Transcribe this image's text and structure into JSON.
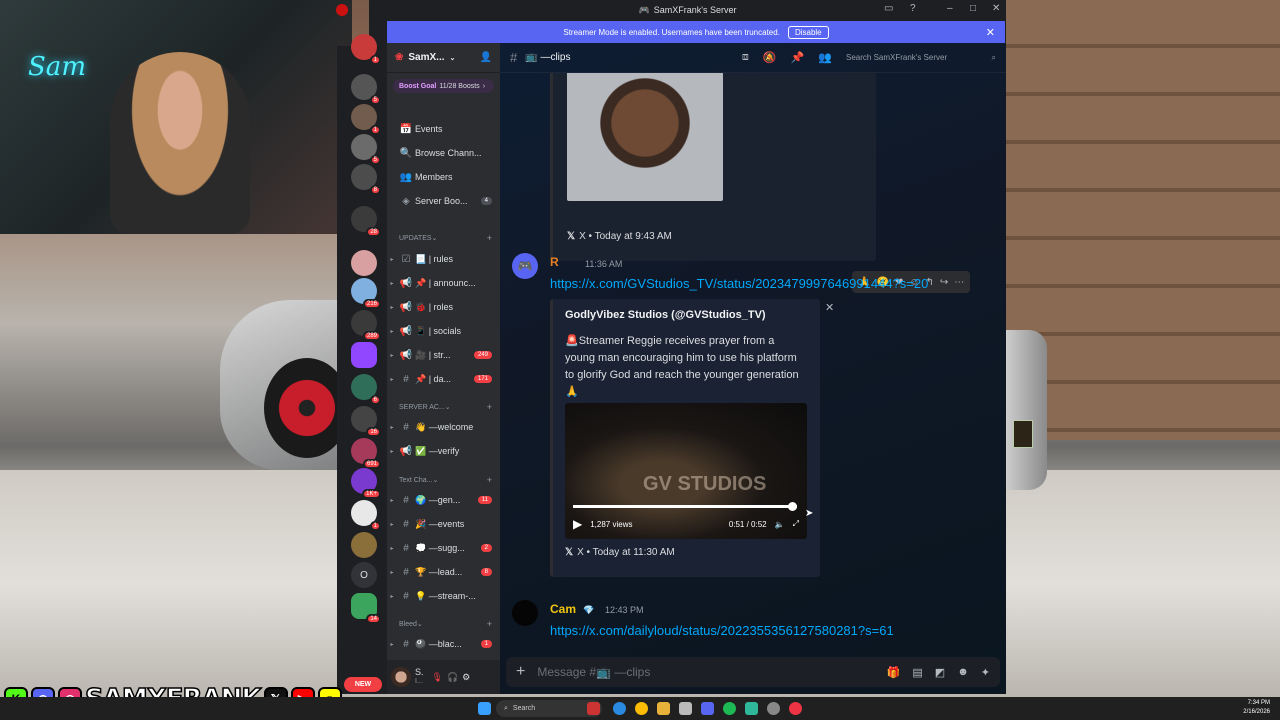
{
  "window": {
    "title": "SamXFrank's Server"
  },
  "streamer_banner": {
    "text": "Streamer Mode is enabled. Usernames have been truncated.",
    "disable_label": "Disable"
  },
  "server_rail": {
    "badges": [
      "1",
      "5",
      "1",
      "5",
      "8",
      "28",
      "216",
      "289",
      "6",
      "16",
      "691",
      "1K+",
      "1",
      "14"
    ],
    "new_label": "NEW",
    "letter_server": "O"
  },
  "sidebar": {
    "server_name": "SamX...",
    "boost_goal": "Boost Goal",
    "boost_progress": "11/28 Boosts",
    "items": [
      {
        "icon": "📅",
        "label": "Events"
      },
      {
        "icon": "🔍",
        "label": "Browse Chann..."
      },
      {
        "icon": "👥",
        "label": "Members"
      },
      {
        "icon": "◈",
        "label": "Server Boo...",
        "count": "4"
      }
    ],
    "cat_updates": "UPDATES",
    "updates_channels": [
      {
        "icon": "☑",
        "label": "📃 | rules"
      },
      {
        "icon": "📢",
        "label": "📌 | announc..."
      },
      {
        "icon": "📢",
        "label": "🐞 | roles"
      },
      {
        "icon": "📢",
        "label": "📱 | socials"
      },
      {
        "icon": "📢",
        "label": "🎥 | str...",
        "count": "249"
      },
      {
        "icon": "#",
        "label": "📌 | da...",
        "count": "171"
      }
    ],
    "cat_server": "SERVER AC...",
    "server_channels": [
      {
        "icon": "#",
        "label": "👋 —welcome"
      },
      {
        "icon": "📢",
        "label": "✅ —verify"
      }
    ],
    "cat_text": "Text Cha...",
    "text_channels": [
      {
        "icon": "#",
        "label": "🌍 —gen...",
        "count": "11"
      },
      {
        "icon": "#",
        "label": "🎉 —events"
      },
      {
        "icon": "#",
        "label": "💭 —sugg...",
        "count": "2"
      },
      {
        "icon": "#",
        "label": "🏆 —lead...",
        "count": "8"
      },
      {
        "icon": "#",
        "label": "💡 —stream-..."
      }
    ],
    "cat_bleed": "Bleed",
    "bleed_channels": [
      {
        "icon": "#",
        "label": "🎱 —blac...",
        "count": "1"
      }
    ],
    "user": {
      "name": "S.",
      "sub": "I..."
    }
  },
  "channel": {
    "name": "📺 —clips",
    "search_placeholder": "Search SamXFrank's Server"
  },
  "messages": {
    "embed1_footer": "X • Today at 9:43 AM",
    "msg2": {
      "author": "R",
      "time": "11:36 AM",
      "link": "https://x.com/GVStudios_TV/status/2023479997646991444?s=20",
      "embed_author": "GodlyVibez Studios (@GVStudios_TV)",
      "embed_desc": "🚨Streamer Reggie receives prayer from a young man encouraging him to use his platform to glorify God and reach the younger generation🙏",
      "video_watermark": "GV STUDIOS",
      "views": "1,287 views",
      "time_display": "0:51 / 0:52",
      "progress": 0.98,
      "footer": "X • Today at 11:30 AM"
    },
    "msg3": {
      "author": "Cam",
      "time": "12:43 PM",
      "link": "https://x.com/dailyloud/status/2022355356127580281?s=61"
    }
  },
  "composer": {
    "placeholder": "Message #📺 —clips"
  },
  "overlay": {
    "brand": "SAMXFRANK"
  },
  "taskbar": {
    "search": "Search",
    "time": "7:34 PM",
    "date": "2/16/2026"
  }
}
